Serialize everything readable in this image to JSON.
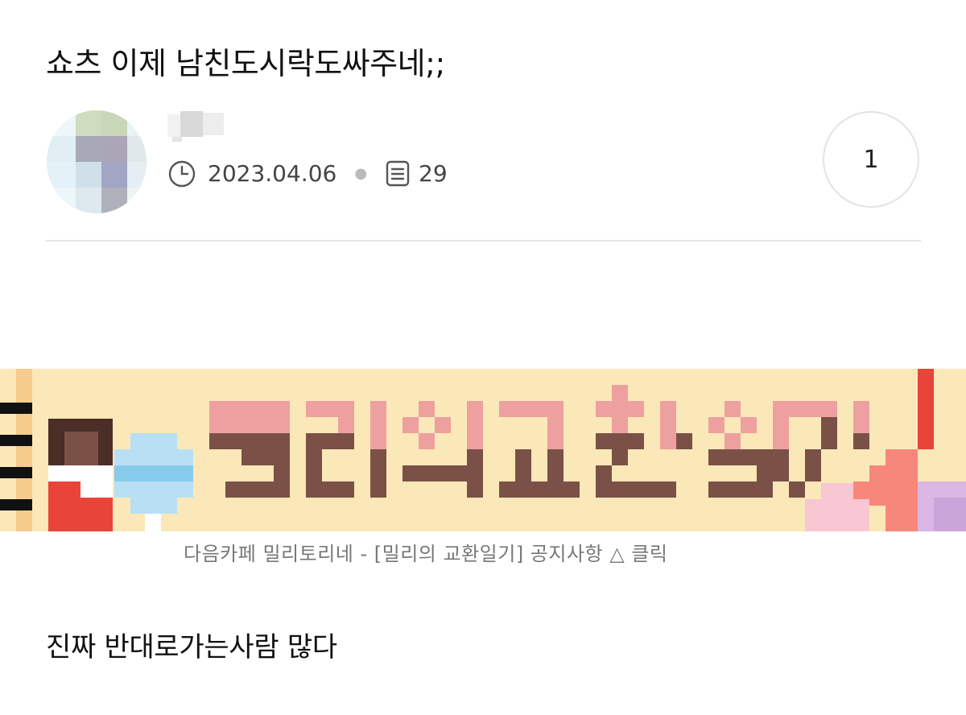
{
  "post": {
    "title": "쇼츠 이제 남친도시락도싸주네;;",
    "date": "2023.04.06",
    "comment_count": "29",
    "like_count": "1",
    "body": "진짜 반대로가는사람 많다"
  },
  "banner": {
    "caption": "다음카페 밀리토리네 - [밀리의 교환일기] 공지사항 △ 클릭",
    "pixel_title": "밀리의교환일기!",
    "colors": {
      "background": "#FBE8B8",
      "pink": "#EEA0A0",
      "brown": "#7B5147",
      "accent_red": "#E8443A"
    }
  },
  "icons": {
    "clock": "clock-icon",
    "document": "document-icon"
  },
  "colors": {
    "divider": "#E6E6E6",
    "meta_text": "#444444",
    "caption_text": "#777777"
  }
}
